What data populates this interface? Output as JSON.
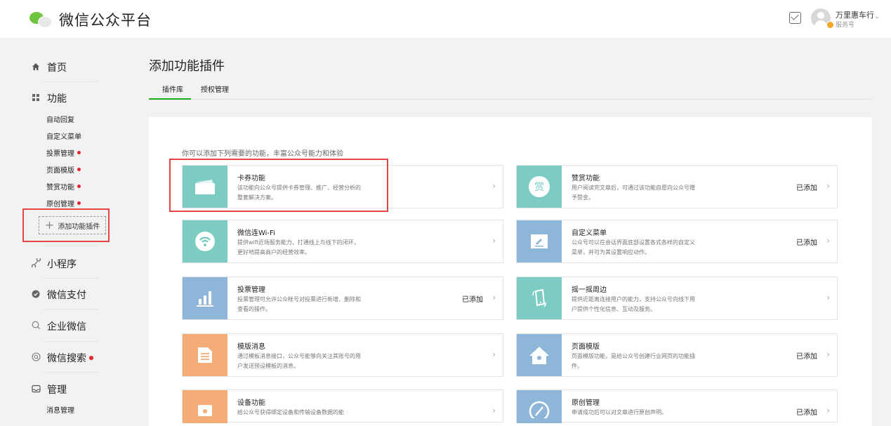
{
  "header": {
    "logo_text": "微信公众平台",
    "account_name": "万里惠车行",
    "account_type": "服务号",
    "caret": "⌄"
  },
  "sidebar": {
    "home": "首页",
    "functions": "功能",
    "sub_items": [
      {
        "label": "自动回复",
        "dot": false
      },
      {
        "label": "自定义菜单",
        "dot": false
      },
      {
        "label": "投票管理",
        "dot": true
      },
      {
        "label": "页面模版",
        "dot": true
      },
      {
        "label": "赞赏功能",
        "dot": true
      },
      {
        "label": "原创管理",
        "dot": true
      }
    ],
    "add_plugin": "添加功能插件",
    "add_plugin_plus": "+",
    "mini_program": "小程序",
    "wechat_pay": "微信支付",
    "wework": "企业微信",
    "wechat_search": "微信搜索",
    "manage": "管理",
    "msg_manage": "消息管理"
  },
  "main": {
    "title": "添加功能插件",
    "tabs": [
      "插件库",
      "授权管理"
    ],
    "intro": "你可以添加下列需要的功能，丰富公众号能力和体验",
    "arrow": "›",
    "cards": [
      {
        "title": "卡券功能",
        "desc": "该功能向公众号提供卡券管理、推广、经营分析的整套解决方案。",
        "status": "",
        "icon": "card-icon",
        "color": "#7cccc4"
      },
      {
        "title": "赞赏功能",
        "desc": "用户阅读完文章后，可通过该功能自愿向公众号赠予赞金。",
        "status": "已添加",
        "icon": "reward-icon",
        "color": "#7cccc4",
        "icon_text": "赏"
      },
      {
        "title": "微信连Wi-Fi",
        "desc": "提供wifi近场服务能力，打通线上与线下的闭环，更好地提高商户的经营效率。",
        "status": "",
        "icon": "wifi-icon",
        "color": "#7cccc4"
      },
      {
        "title": "自定义菜单",
        "desc": "公众号可以在会话界面底部设置各式各样的自定义菜单，并可为其设置响应动作。",
        "status": "已添加",
        "icon": "edit-icon",
        "color": "#8eb6d8"
      },
      {
        "title": "投票管理",
        "desc": "投票管理可允许公众帐号对投票进行新增、删除和查看的操作。",
        "status": "已添加",
        "icon": "chart-icon",
        "color": "#8eb6d8"
      },
      {
        "title": "摇一摇周边",
        "desc": "提供近距离连接用户的能力，支持公众号向线下用户提供个性化信息、互动及服务。",
        "status": "",
        "icon": "shake-icon",
        "color": "#7cccc4"
      },
      {
        "title": "模版消息",
        "desc": "通过模板消息接口，公众号能够向关注其账号的用户发送预设模板的消息。",
        "status": "",
        "icon": "template-icon",
        "color": "#f5ad78"
      },
      {
        "title": "页面模版",
        "desc": "页面模版功能，是给公众号创建行业网页的功能插件。",
        "status": "已添加",
        "icon": "home-icon",
        "color": "#8eb6d8"
      },
      {
        "title": "设备功能",
        "desc": "给公众号获得绑定设备和传输设备数据的能",
        "status": "",
        "icon": "device-icon",
        "color": "#f5ad78"
      },
      {
        "title": "原创管理",
        "desc": "申请成功后可以对文章进行原创声明。",
        "status": "已添加",
        "icon": "original-icon",
        "color": "#8eb6d8"
      }
    ]
  }
}
